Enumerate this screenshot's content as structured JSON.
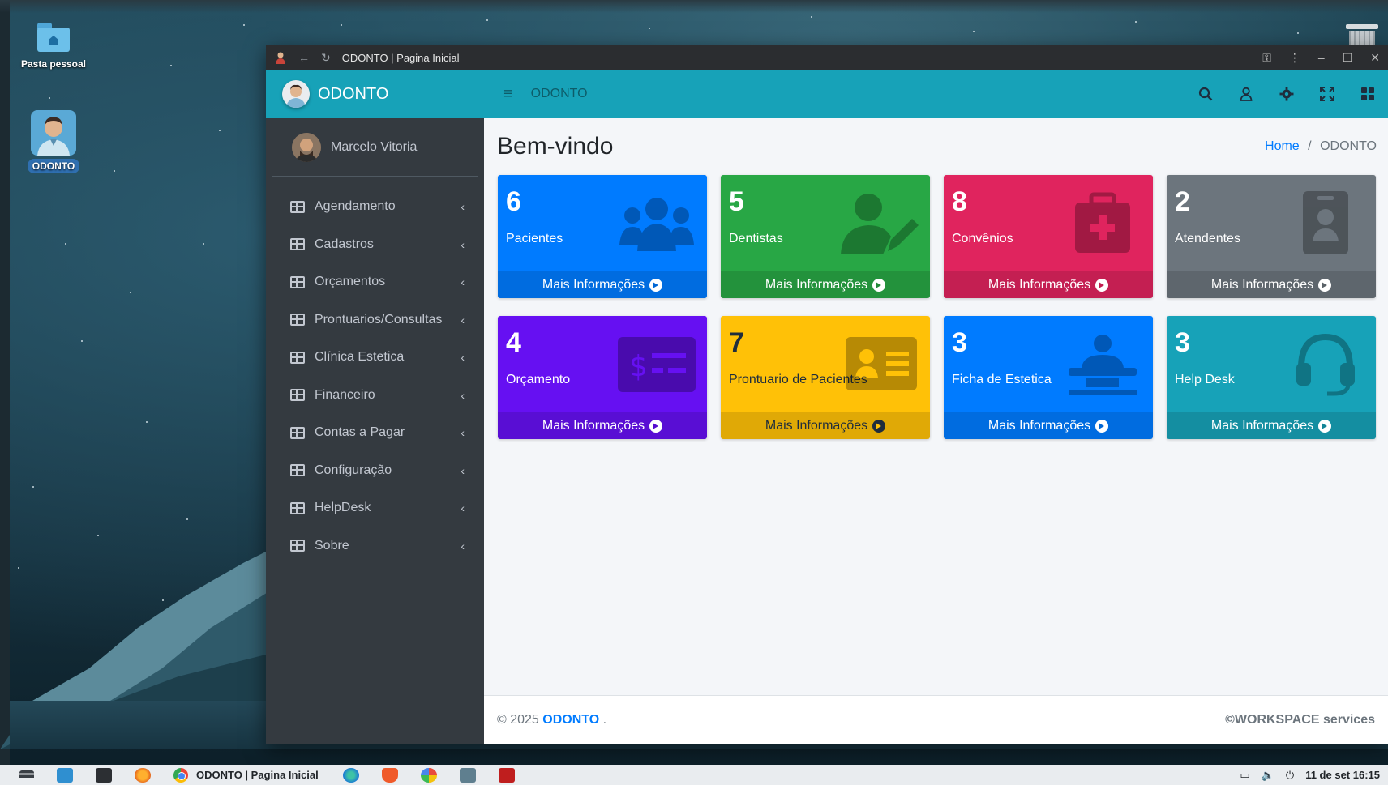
{
  "desktop": {
    "icons": [
      {
        "label": "Pasta pessoal"
      },
      {
        "label": "ODONTO"
      }
    ]
  },
  "window": {
    "title": "ODONTO | Pagina Inicial"
  },
  "sidebar": {
    "brand": "ODONTO",
    "user": "Marcelo Vitoria",
    "items": [
      {
        "label": "Agendamento"
      },
      {
        "label": "Cadastros"
      },
      {
        "label": "Orçamentos"
      },
      {
        "label": "Prontuarios/Consultas"
      },
      {
        "label": "Clínica Estetica"
      },
      {
        "label": "Financeiro"
      },
      {
        "label": "Contas a Pagar"
      },
      {
        "label": "Configuração"
      },
      {
        "label": "HelpDesk"
      },
      {
        "label": "Sobre"
      }
    ]
  },
  "topnav": {
    "title": "ODONTO"
  },
  "page": {
    "title": "Bem-vindo",
    "breadcrumb_home": "Home",
    "breadcrumb_sep": "/",
    "breadcrumb_current": "ODONTO"
  },
  "boxes": [
    {
      "number": "6",
      "label": "Pacientes",
      "footer": "Mais Informações",
      "color": "#007bff",
      "icon": "users-icon"
    },
    {
      "number": "5",
      "label": "Dentistas",
      "footer": "Mais Informações",
      "color": "#28a745",
      "icon": "user-edit-icon"
    },
    {
      "number": "8",
      "label": "Convênios",
      "footer": "Mais Informações",
      "color": "#e0245e",
      "icon": "medkit-icon"
    },
    {
      "number": "2",
      "label": "Atendentes",
      "footer": "Mais Informações",
      "color": "#6c757d",
      "icon": "id-badge-icon"
    },
    {
      "number": "4",
      "label": "Orçamento",
      "footer": "Mais Informações",
      "color": "#6610f2",
      "icon": "money-bill-icon"
    },
    {
      "number": "7",
      "label": "Prontuario de Pacientes",
      "footer": "Mais Informações",
      "color": "#ffc107",
      "icon": "id-card-icon"
    },
    {
      "number": "3",
      "label": "Ficha de Estetica",
      "footer": "Mais Informações",
      "color": "#007bff",
      "icon": "procedure-icon"
    },
    {
      "number": "3",
      "label": "Help Desk",
      "footer": "Mais Informações",
      "color": "#17a2b8",
      "icon": "headset-icon"
    }
  ],
  "footer": {
    "copyright": "© 2025",
    "brand": "ODONTO",
    "dot": ".",
    "right": "©WORKSPACE services"
  },
  "taskbar": {
    "active_window": "ODONTO | Pagina Inicial",
    "clock": "11 de set  16:15"
  }
}
